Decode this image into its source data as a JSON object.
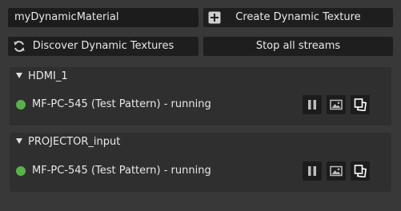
{
  "material_input": {
    "value": "myDynamicMaterial"
  },
  "toolbar": {
    "create_label": "Create Dynamic Texture",
    "create_icon": "plus-square-icon",
    "discover_label": "Discover Dynamic Textures",
    "discover_icon": "refresh-icon",
    "stop_label": "Stop all streams"
  },
  "streams": [
    {
      "name": "HDMI_1",
      "source_label": "MF-PC-545 (Test Pattern) - running",
      "status_color": "#5ab14a",
      "controls": [
        "pause-icon",
        "image-icon",
        "copy-icon"
      ]
    },
    {
      "name": "PROJECTOR_input",
      "source_label": "MF-PC-545 (Test Pattern) - running",
      "status_color": "#5ab14a",
      "controls": [
        "pause-icon",
        "image-icon",
        "copy-icon"
      ]
    }
  ]
}
